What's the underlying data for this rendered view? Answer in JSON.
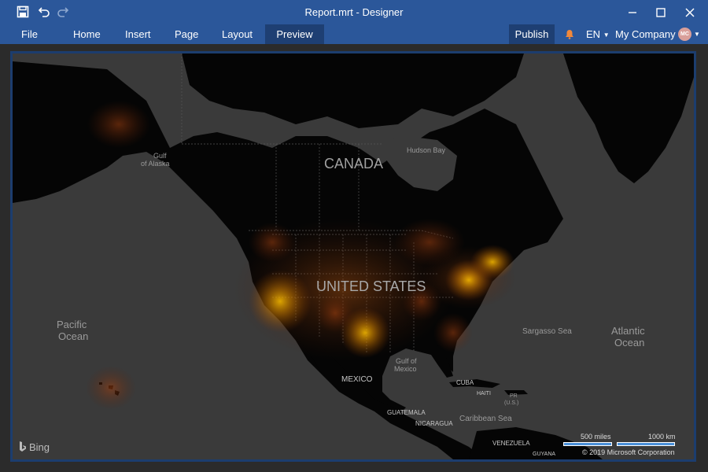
{
  "window": {
    "title": "Report.mrt - Designer"
  },
  "menu": {
    "file": "File",
    "tabs": [
      "Home",
      "Insert",
      "Page",
      "Layout",
      "Preview"
    ],
    "publish": "Publish",
    "language": "EN",
    "company": "My Company",
    "avatar_initials": "MC"
  },
  "map": {
    "labels": {
      "canada": "CANADA",
      "united_states": "UNITED STATES",
      "mexico": "MEXICO",
      "hudson_bay": "Hudson Bay",
      "gulf_of_alaska_1": "Gulf",
      "gulf_of_alaska_2": "of Alaska",
      "pacific_1": "Pacific",
      "pacific_2": "Ocean",
      "atlantic_1": "Atlantic",
      "atlantic_2": "Ocean",
      "sargasso": "Sargasso Sea",
      "gulf_mexico_1": "Gulf of",
      "gulf_mexico_2": "Mexico",
      "cuba": "CUBA",
      "haiti": "HAITI",
      "pr_1": "PR",
      "pr_2": "(U.S.)",
      "guatemala": "GUATEMALA",
      "nicaragua": "NICARAGUA",
      "caribbean": "Caribbean Sea",
      "venezuela": "VENEZUELA",
      "guyana": "GUYANA"
    },
    "bing": "Bing",
    "scale_miles": "500 miles",
    "scale_km": "1000 km",
    "copyright": "© 2019 Microsoft Corporation"
  },
  "colors": {
    "titlebar": "#2b579a",
    "active_tab": "#1e3f73",
    "map_frame": "#1c3d6e",
    "water": "#3a3a3a",
    "land": "#050505",
    "heat": "#ffb000",
    "bell": "#f2883a"
  }
}
